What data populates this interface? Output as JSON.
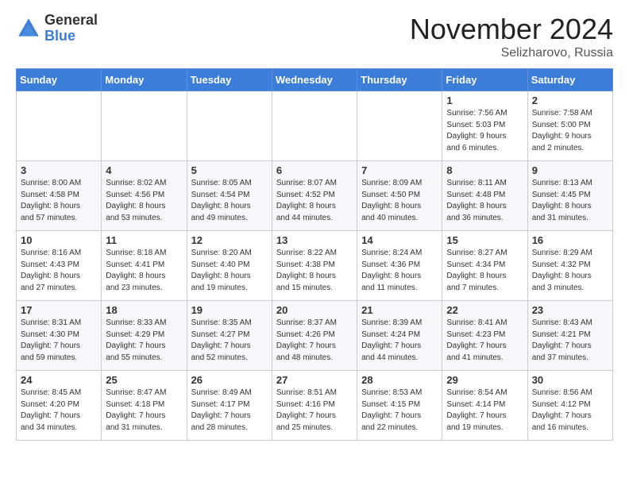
{
  "logo": {
    "general": "General",
    "blue": "Blue"
  },
  "title": "November 2024",
  "location": "Selizharovo, Russia",
  "days_of_week": [
    "Sunday",
    "Monday",
    "Tuesday",
    "Wednesday",
    "Thursday",
    "Friday",
    "Saturday"
  ],
  "weeks": [
    [
      {
        "day": "",
        "info": ""
      },
      {
        "day": "",
        "info": ""
      },
      {
        "day": "",
        "info": ""
      },
      {
        "day": "",
        "info": ""
      },
      {
        "day": "",
        "info": ""
      },
      {
        "day": "1",
        "info": "Sunrise: 7:56 AM\nSunset: 5:03 PM\nDaylight: 9 hours\nand 6 minutes."
      },
      {
        "day": "2",
        "info": "Sunrise: 7:58 AM\nSunset: 5:00 PM\nDaylight: 9 hours\nand 2 minutes."
      }
    ],
    [
      {
        "day": "3",
        "info": "Sunrise: 8:00 AM\nSunset: 4:58 PM\nDaylight: 8 hours\nand 57 minutes."
      },
      {
        "day": "4",
        "info": "Sunrise: 8:02 AM\nSunset: 4:56 PM\nDaylight: 8 hours\nand 53 minutes."
      },
      {
        "day": "5",
        "info": "Sunrise: 8:05 AM\nSunset: 4:54 PM\nDaylight: 8 hours\nand 49 minutes."
      },
      {
        "day": "6",
        "info": "Sunrise: 8:07 AM\nSunset: 4:52 PM\nDaylight: 8 hours\nand 44 minutes."
      },
      {
        "day": "7",
        "info": "Sunrise: 8:09 AM\nSunset: 4:50 PM\nDaylight: 8 hours\nand 40 minutes."
      },
      {
        "day": "8",
        "info": "Sunrise: 8:11 AM\nSunset: 4:48 PM\nDaylight: 8 hours\nand 36 minutes."
      },
      {
        "day": "9",
        "info": "Sunrise: 8:13 AM\nSunset: 4:45 PM\nDaylight: 8 hours\nand 31 minutes."
      }
    ],
    [
      {
        "day": "10",
        "info": "Sunrise: 8:16 AM\nSunset: 4:43 PM\nDaylight: 8 hours\nand 27 minutes."
      },
      {
        "day": "11",
        "info": "Sunrise: 8:18 AM\nSunset: 4:41 PM\nDaylight: 8 hours\nand 23 minutes."
      },
      {
        "day": "12",
        "info": "Sunrise: 8:20 AM\nSunset: 4:40 PM\nDaylight: 8 hours\nand 19 minutes."
      },
      {
        "day": "13",
        "info": "Sunrise: 8:22 AM\nSunset: 4:38 PM\nDaylight: 8 hours\nand 15 minutes."
      },
      {
        "day": "14",
        "info": "Sunrise: 8:24 AM\nSunset: 4:36 PM\nDaylight: 8 hours\nand 11 minutes."
      },
      {
        "day": "15",
        "info": "Sunrise: 8:27 AM\nSunset: 4:34 PM\nDaylight: 8 hours\nand 7 minutes."
      },
      {
        "day": "16",
        "info": "Sunrise: 8:29 AM\nSunset: 4:32 PM\nDaylight: 8 hours\nand 3 minutes."
      }
    ],
    [
      {
        "day": "17",
        "info": "Sunrise: 8:31 AM\nSunset: 4:30 PM\nDaylight: 7 hours\nand 59 minutes."
      },
      {
        "day": "18",
        "info": "Sunrise: 8:33 AM\nSunset: 4:29 PM\nDaylight: 7 hours\nand 55 minutes."
      },
      {
        "day": "19",
        "info": "Sunrise: 8:35 AM\nSunset: 4:27 PM\nDaylight: 7 hours\nand 52 minutes."
      },
      {
        "day": "20",
        "info": "Sunrise: 8:37 AM\nSunset: 4:26 PM\nDaylight: 7 hours\nand 48 minutes."
      },
      {
        "day": "21",
        "info": "Sunrise: 8:39 AM\nSunset: 4:24 PM\nDaylight: 7 hours\nand 44 minutes."
      },
      {
        "day": "22",
        "info": "Sunrise: 8:41 AM\nSunset: 4:23 PM\nDaylight: 7 hours\nand 41 minutes."
      },
      {
        "day": "23",
        "info": "Sunrise: 8:43 AM\nSunset: 4:21 PM\nDaylight: 7 hours\nand 37 minutes."
      }
    ],
    [
      {
        "day": "24",
        "info": "Sunrise: 8:45 AM\nSunset: 4:20 PM\nDaylight: 7 hours\nand 34 minutes."
      },
      {
        "day": "25",
        "info": "Sunrise: 8:47 AM\nSunset: 4:18 PM\nDaylight: 7 hours\nand 31 minutes."
      },
      {
        "day": "26",
        "info": "Sunrise: 8:49 AM\nSunset: 4:17 PM\nDaylight: 7 hours\nand 28 minutes."
      },
      {
        "day": "27",
        "info": "Sunrise: 8:51 AM\nSunset: 4:16 PM\nDaylight: 7 hours\nand 25 minutes."
      },
      {
        "day": "28",
        "info": "Sunrise: 8:53 AM\nSunset: 4:15 PM\nDaylight: 7 hours\nand 22 minutes."
      },
      {
        "day": "29",
        "info": "Sunrise: 8:54 AM\nSunset: 4:14 PM\nDaylight: 7 hours\nand 19 minutes."
      },
      {
        "day": "30",
        "info": "Sunrise: 8:56 AM\nSunset: 4:12 PM\nDaylight: 7 hours\nand 16 minutes."
      }
    ]
  ]
}
